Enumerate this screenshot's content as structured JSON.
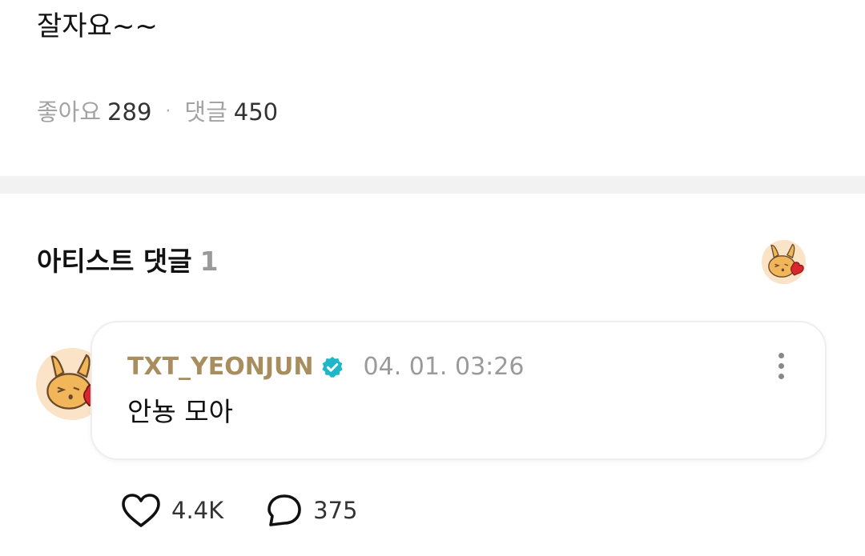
{
  "post": {
    "text": "잘자요~~",
    "likes_label": "좋아요",
    "likes_count": "289",
    "separator": "·",
    "comments_label": "댓글",
    "comments_count": "450"
  },
  "artist_comments": {
    "title": "아티스트 댓글",
    "count": "1",
    "header_avatar_icon": "bunny-heart-avatar-icon"
  },
  "comment": {
    "author": "TXT_YEONJUN",
    "verified_icon": "verified-badge-icon",
    "timestamp": "04. 01. 03:26",
    "body": "안뇽 모아",
    "avatar_icon": "bunny-heart-avatar-icon",
    "more_icon": "more-vertical-icon",
    "likes": "4.4K",
    "replies": "375",
    "like_icon": "heart-outline-icon",
    "reply_icon": "comment-bubble-icon"
  },
  "colors": {
    "author": "#a88e5f",
    "verified": "#1fb7c7",
    "divider": "#f2f2f2",
    "avatar_bg": "#fbe3c7"
  }
}
